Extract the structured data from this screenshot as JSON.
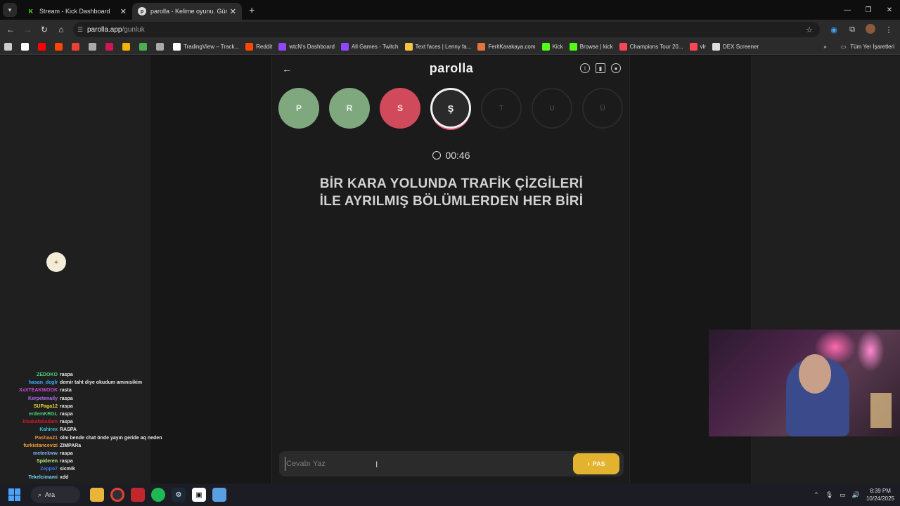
{
  "browser": {
    "tabs": [
      {
        "title": "Stream - Kick Dashboard",
        "favicon": "kick-icon",
        "active": false
      },
      {
        "title": "parolla - Kelime oyunu. Günlük",
        "favicon": "parolla-icon",
        "active": true
      }
    ],
    "url_host": "parolla.app",
    "url_path": "/gunluk",
    "bookmarks": [
      {
        "label": "",
        "icon": "apps-icon",
        "color": "#cccccc"
      },
      {
        "label": "",
        "icon": "x-icon",
        "color": "#ffffff"
      },
      {
        "label": "",
        "icon": "youtube-icon",
        "color": "#ff0000"
      },
      {
        "label": "",
        "icon": "reddit-icon",
        "color": "#ff4500"
      },
      {
        "label": "",
        "icon": "gmail-icon",
        "color": "#ea4335"
      },
      {
        "label": "",
        "icon": "globe-icon",
        "color": "#aaaaaa"
      },
      {
        "label": "",
        "icon": "yahoo-icon",
        "color": "#d4145a"
      },
      {
        "label": "",
        "icon": "g-icon",
        "color": "#f5b400"
      },
      {
        "label": "",
        "icon": "leaf-icon",
        "color": "#4caf50"
      },
      {
        "label": "",
        "icon": "globe-icon",
        "color": "#aaaaaa"
      },
      {
        "label": "TradingView – Track...",
        "icon": "tradingview-icon",
        "color": "#ffffff"
      },
      {
        "label": "Reddit",
        "icon": "reddit-icon",
        "color": "#ff4500"
      },
      {
        "label": "wtcN's Dashboard",
        "icon": "twitch-icon",
        "color": "#9146ff"
      },
      {
        "label": "All Games - Twitch",
        "icon": "twitch-icon",
        "color": "#9146ff"
      },
      {
        "label": "Text faces | Lenny fa...",
        "icon": "emoji-icon",
        "color": "#f5c542"
      },
      {
        "label": "FeritKarakaya.com",
        "icon": "site-icon",
        "color": "#e0763a"
      },
      {
        "label": "Kick",
        "icon": "kick-icon",
        "color": "#53fc18"
      },
      {
        "label": "Browse | kick",
        "icon": "kick-icon",
        "color": "#53fc18"
      },
      {
        "label": "Champions Tour 20...",
        "icon": "valorant-icon",
        "color": "#ff4655"
      },
      {
        "label": "vlr",
        "icon": "vlr-icon",
        "color": "#ff4655"
      },
      {
        "label": "DEX Screener",
        "icon": "dex-icon",
        "color": "#dddddd"
      }
    ],
    "bookmarks_folder": "Tüm Yer İşaretleri"
  },
  "game": {
    "brand": "parolla",
    "letters": [
      {
        "char": "P",
        "state": "correct"
      },
      {
        "char": "R",
        "state": "correct"
      },
      {
        "char": "S",
        "state": "wrong"
      },
      {
        "char": "Ş",
        "state": "current"
      },
      {
        "char": "T",
        "state": "pending"
      },
      {
        "char": "U",
        "state": "pending"
      },
      {
        "char": "Ü",
        "state": "pending"
      }
    ],
    "timer": "00:46",
    "question_line1": "BİR KARA YOLUNDA TRAFİK ÇİZGİLERİ",
    "question_line2": "İLE AYRILMIŞ BÖLÜMLERDEN HER BİRİ",
    "answer_placeholder": "Cevabı Yaz",
    "pass_label": "PAS",
    "colors": {
      "correct": "#7fa87f",
      "wrong": "#d04a5c",
      "pass": "#e3b22e"
    }
  },
  "chat": [
    {
      "user": "ZEDOKO",
      "msg": "raspa",
      "color": "#49d17a"
    },
    {
      "user": "hasan_dcglr",
      "msg": "demir taht diye okudum amınısikim",
      "color": "#3cb0ff"
    },
    {
      "user": "XxXTEAKWOOK",
      "msg": "rasta",
      "color": "#c74bd6"
    },
    {
      "user": "Kerpetenaily",
      "msg": "raspa",
      "color": "#b06cf0"
    },
    {
      "user": "SUPaga12",
      "msg": "raspa",
      "color": "#f0d23a"
    },
    {
      "user": "erdemKRGL",
      "msg": "raspa",
      "color": "#49d17a"
    },
    {
      "user": "kisakafalıadam",
      "msg": "raspa",
      "color": "#d01a2a"
    },
    {
      "user": "Kahirex",
      "msg": "RASPA",
      "color": "#3cc3d8"
    },
    {
      "user": "Pashaa21",
      "msg": "olm bende chat önde yayın geride aq neden",
      "color": "#f08a3a"
    },
    {
      "user": "furkistancevizi",
      "msg": "ZIMPARa",
      "color": "#f0a03a"
    },
    {
      "user": "meteekww",
      "msg": "raspa",
      "color": "#7ab0f0"
    },
    {
      "user": "Spideren",
      "msg": "raspa",
      "color": "#b0f07a"
    },
    {
      "user": "Zeppo7",
      "msg": "sicmik",
      "color": "#3a7af0"
    },
    {
      "user": "Tekelcimami",
      "msg": "xdd",
      "color": "#7ad0f0"
    }
  ],
  "taskbar": {
    "search_label": "Ara",
    "time": "8:39 PM",
    "date": "10/24/2025"
  }
}
